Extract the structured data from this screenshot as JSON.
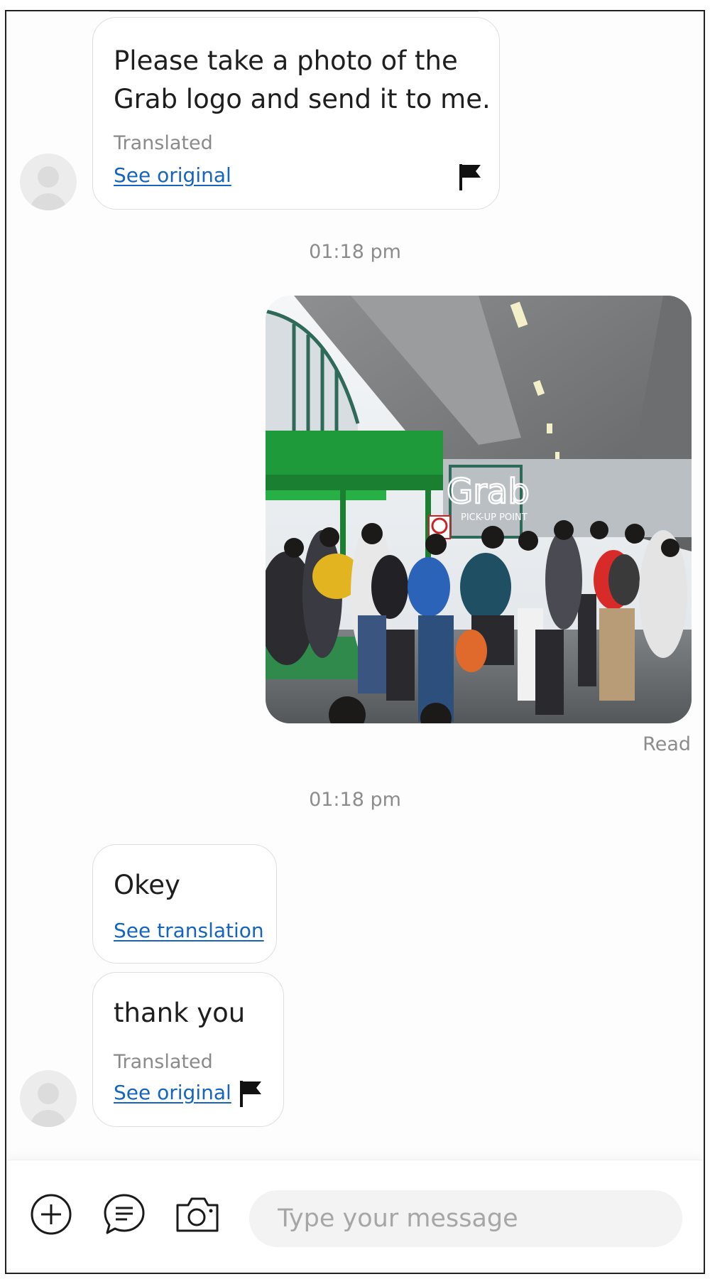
{
  "messages": [
    {
      "text": "Please take a photo of the\nGrab logo and send it to me.",
      "translated_label": "Translated",
      "link": "See original"
    },
    {
      "text": "Okey",
      "link": "See translation"
    },
    {
      "text": "thank you",
      "translated_label": "Translated",
      "link": "See original"
    }
  ],
  "timestamps": [
    "01:18 pm",
    "01:18 pm"
  ],
  "photo": {
    "sign_text": "Grab",
    "sign_subtext": "PICK-UP POINT"
  },
  "read_status": "Read",
  "composer": {
    "placeholder": "Type your message",
    "icons": [
      "plus-icon",
      "chat-bubble-icon",
      "camera-icon"
    ]
  },
  "colors": {
    "link": "#1565c0",
    "grab_green": "#1f9a3a",
    "muted_text": "#8c8c8c"
  }
}
